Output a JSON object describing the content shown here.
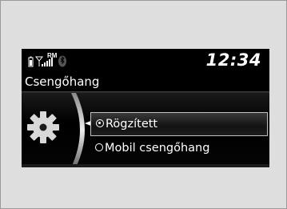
{
  "statusbar": {
    "time": "12:34",
    "icons": [
      "phone-battery-icon",
      "signal-strength-icon",
      "roaming-icon",
      "bluetooth-icon"
    ],
    "roaming_label": "RM"
  },
  "menu": {
    "title": "Csengőhang",
    "options": [
      {
        "label": "Rögzített",
        "selected": true
      },
      {
        "label": "Mobil csengőhang",
        "selected": false
      }
    ]
  },
  "colors": {
    "screen_bg": "#000000",
    "text": "#ffffff",
    "page_bg": "#dcdcdc"
  }
}
